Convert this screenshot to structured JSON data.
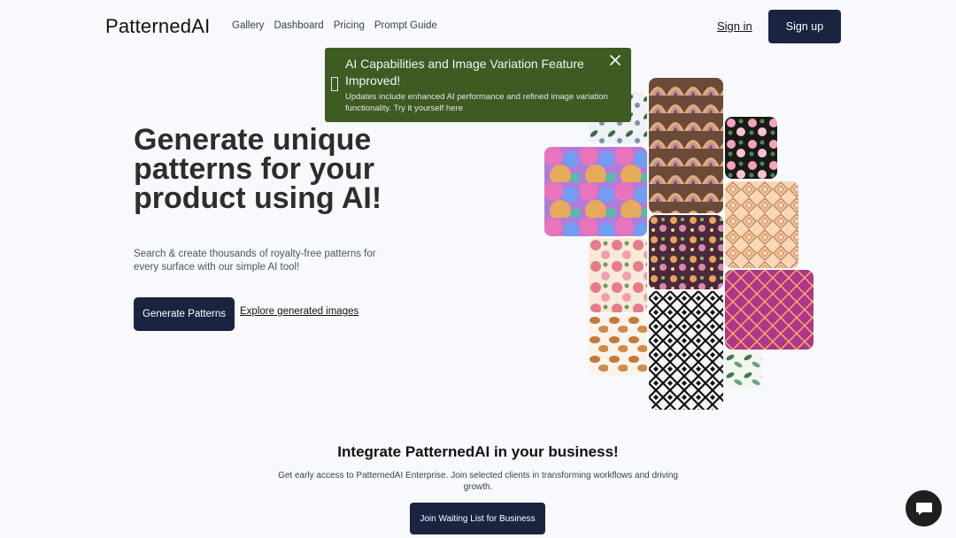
{
  "header": {
    "logo": "PatternedAI",
    "nav": [
      "Gallery",
      "Dashboard",
      "Pricing",
      "Prompt Guide"
    ],
    "sign_in": "Sign in",
    "sign_up": "Sign up"
  },
  "toast": {
    "title": "AI Capabilities and Image Variation Feature Improved!",
    "body": "Updates include enhanced AI performance and refined image variation functionality. Try it yourself here",
    "icon": "info-icon",
    "close_icon": "close-icon",
    "background": "#3e5b22"
  },
  "hero": {
    "title": "Generate unique patterns for your product using AI!",
    "subtitle": "Search & create thousands of royalty-free patterns for every surface with our simple AI tool!",
    "primary_button": "Generate Patterns",
    "secondary_link": "Explore generated images"
  },
  "pattern_gallery": [
    "floral-leaves-pattern",
    "art-deco-fan-pattern",
    "pink-roses-black-pattern",
    "colorful-bubbles-pattern",
    "peach-geometric-pattern",
    "purple-floral-pattern",
    "pink-floral-cream-pattern",
    "magenta-diamond-pattern",
    "black-white-diamond-pattern",
    "pastry-pattern",
    "green-leaves-pattern"
  ],
  "integrate": {
    "title": "Integrate PatternedAI in your business!",
    "subtitle": "Get early access to PatternedAI Enterprise. Join selected clients in transforming workflows and driving growth.",
    "button": "Join Waiting List for Business"
  },
  "chat_icon": "chat-bubble-icon",
  "colors": {
    "primary": "#1a2340",
    "background": "#f8f9fc"
  }
}
